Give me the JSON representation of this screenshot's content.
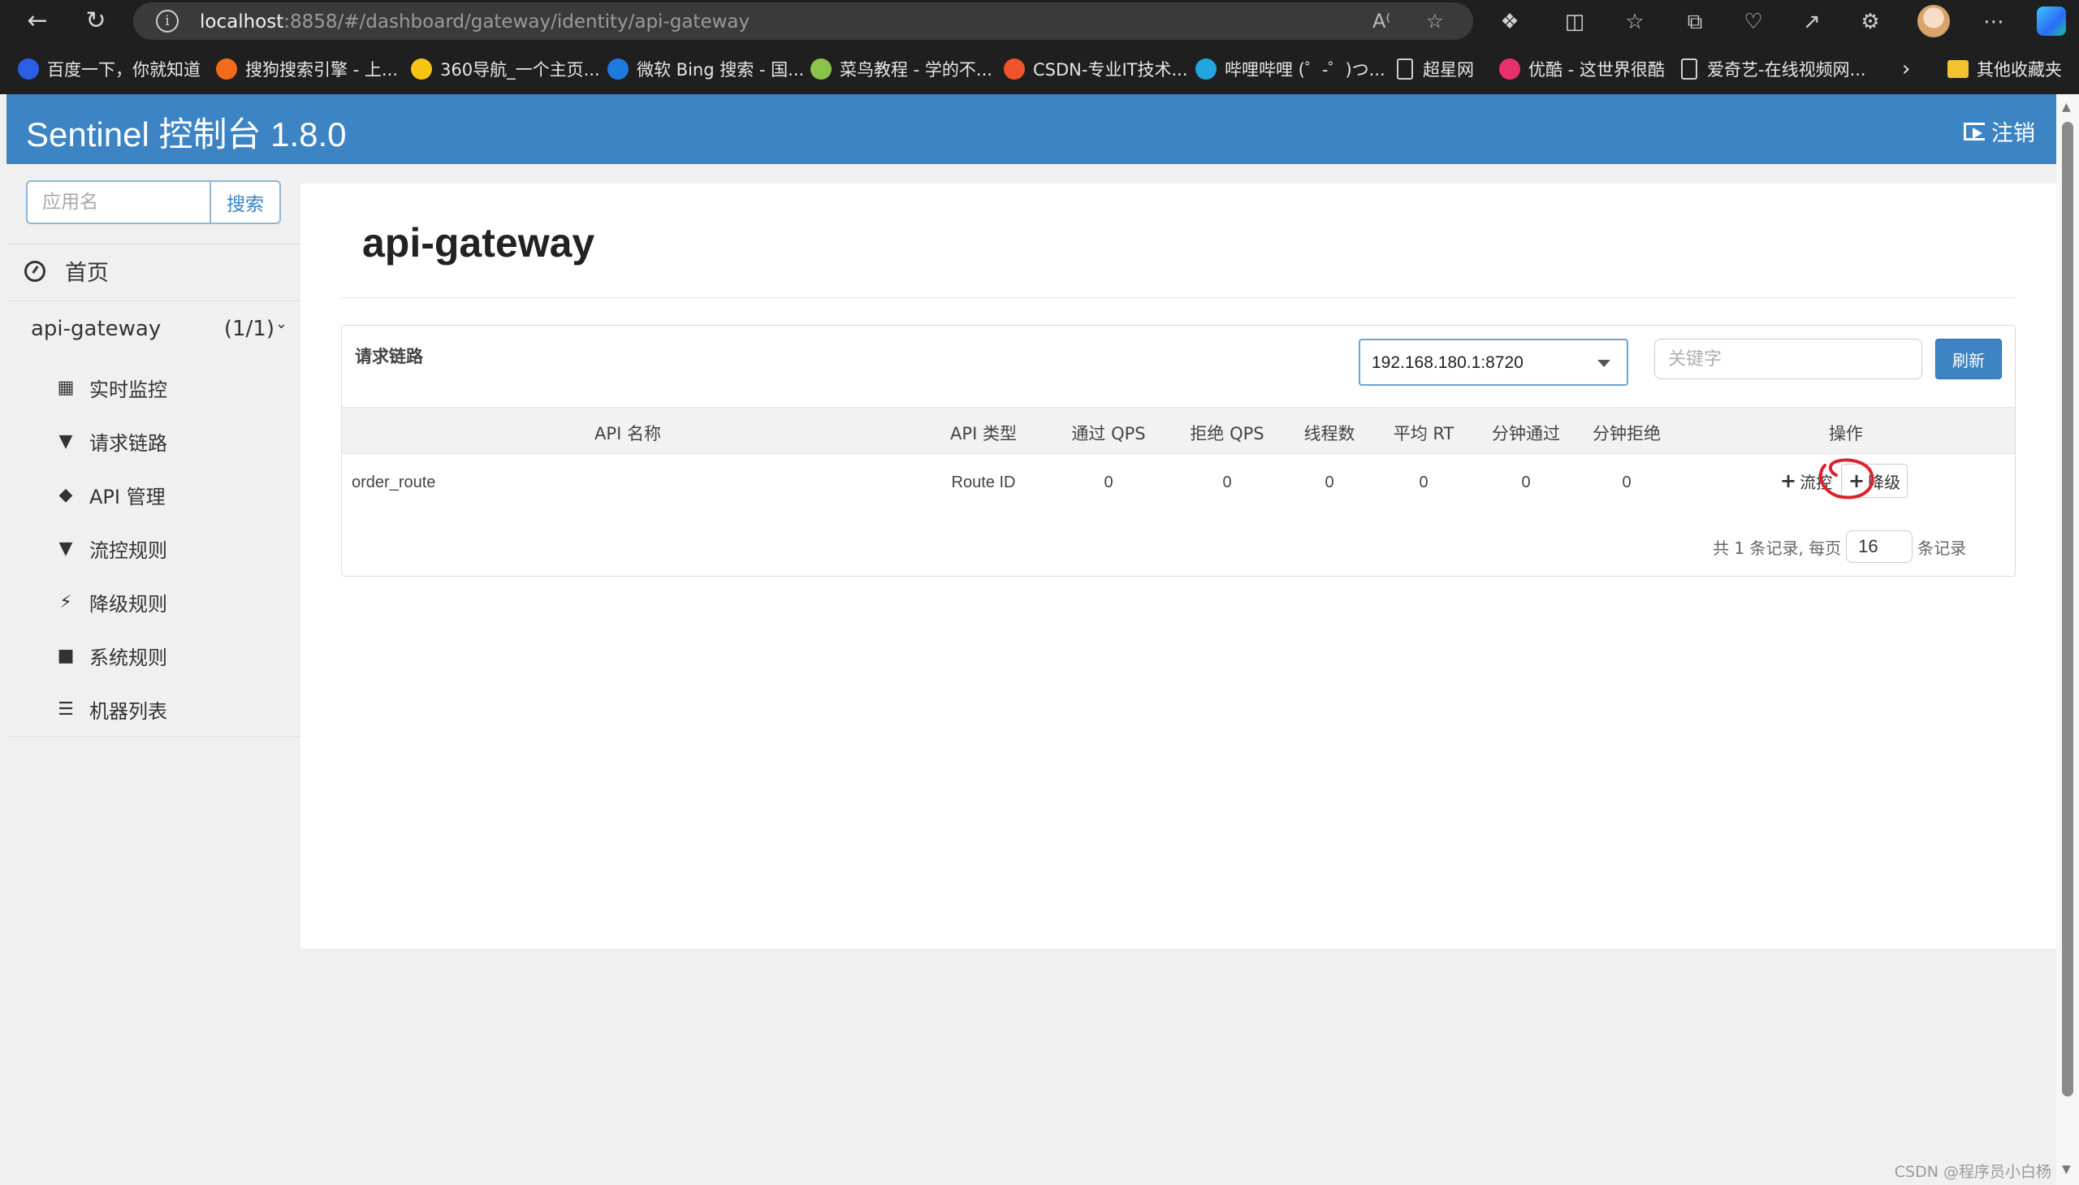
{
  "browser": {
    "url_host": "localhost",
    "url_path": ":8858/#/dashboard/gateway/identity/api-gateway",
    "bookmarks": [
      {
        "label": "百度一下，你就知道",
        "color": "#2b5fe3"
      },
      {
        "label": "搜狗搜索引擎 - 上...",
        "color": "#f26a1b"
      },
      {
        "label": "360导航_一个主页...",
        "color": "#f6c514"
      },
      {
        "label": "微软 Bing 搜索 - 国...",
        "color": "#1f7ae0"
      },
      {
        "label": "菜鸟教程 - 学的不...",
        "color": "#8bc34a"
      },
      {
        "label": "CSDN-专业IT技术...",
        "color": "#f0542d"
      },
      {
        "label": "哔哩哔哩 (゜-゜)つ...",
        "color": "#23a5e0"
      },
      {
        "label": "超星网",
        "color": "doc"
      },
      {
        "label": "优酷 - 这世界很酷",
        "color": "#e8316b"
      },
      {
        "label": "爱奇艺-在线视频网...",
        "color": "doc"
      }
    ],
    "other_bookmarks": "其他收藏夹",
    "icons": [
      "back-icon",
      "refresh-icon",
      "info-icon",
      "read-aloud-icon",
      "favorite-star-icon",
      "extensions-icon",
      "split-screen-icon",
      "favorites-icon",
      "collections-icon",
      "health-icon",
      "share-icon",
      "profile-sync-icon",
      "more-icon"
    ]
  },
  "app": {
    "brand": "Sentinel 控制台 1.8.0",
    "logout": "注销"
  },
  "sidebar": {
    "search_placeholder": "应用名",
    "search_button": "搜索",
    "home": "首页",
    "app_name": "api-gateway",
    "app_count": "(1/1)",
    "menu": [
      {
        "label": "实时监控",
        "icon": "bar-chart-icon"
      },
      {
        "label": "请求链路",
        "icon": "filter-icon"
      },
      {
        "label": "API 管理",
        "icon": "tags-icon"
      },
      {
        "label": "流控规则",
        "icon": "filter-icon"
      },
      {
        "label": "降级规则",
        "icon": "flash-icon"
      },
      {
        "label": "系统规则",
        "icon": "lock-icon"
      },
      {
        "label": "机器列表",
        "icon": "list-icon"
      }
    ]
  },
  "main": {
    "title": "api-gateway",
    "panel_title": "请求链路",
    "machine": "192.168.180.1:8720",
    "keyword_placeholder": "关键字",
    "refresh": "刷新",
    "columns": [
      "API 名称",
      "API 类型",
      "通过 QPS",
      "拒绝 QPS",
      "线程数",
      "平均 RT",
      "分钟通过",
      "分钟拒绝",
      "操作"
    ],
    "rows": [
      {
        "name": "order_route",
        "type": "Route ID",
        "pass_qps": "0",
        "block_qps": "0",
        "threads": "0",
        "avg_rt": "0",
        "min_pass": "0",
        "min_block": "0"
      }
    ],
    "actions": {
      "flow": "流控",
      "degrade": "降级"
    },
    "pager": {
      "prefix": "共 1 条记录, 每页",
      "page_size": "16",
      "suffix": "条记录"
    }
  },
  "watermark": "CSDN @程序员小白杨",
  "colors": {
    "brand": "#3c84c3",
    "annotation": "#e0202a"
  }
}
